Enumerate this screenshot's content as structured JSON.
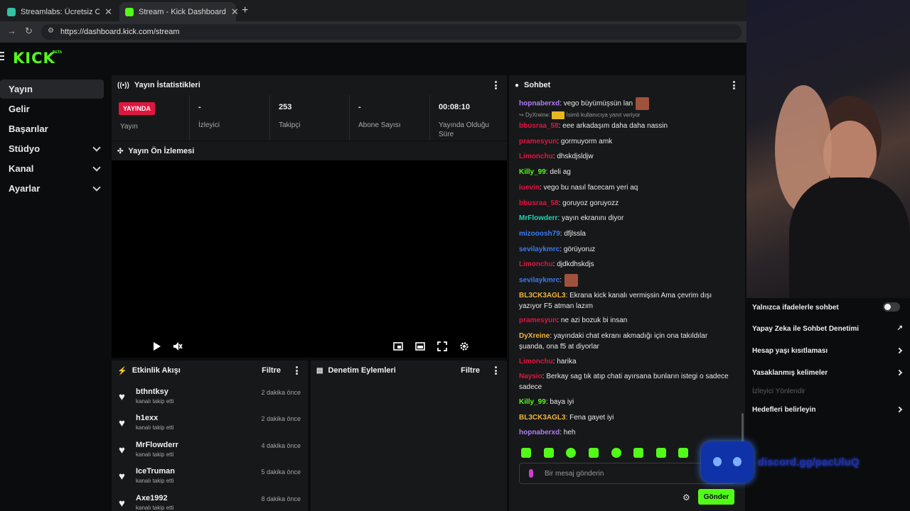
{
  "browser": {
    "tabs": [
      {
        "title": "Streamlabs: Ücretsiz Canlı Yayın",
        "color": "#31c3a2"
      },
      {
        "title": "Stream - Kick Dashboard",
        "color": "#53fc18"
      }
    ],
    "url": "https://dashboard.kick.com/stream"
  },
  "logo": {
    "text": "KICK",
    "beta": "BETA"
  },
  "sidebar": {
    "items": [
      {
        "label": "Yayın"
      },
      {
        "label": "Gelir"
      },
      {
        "label": "Başarılar"
      },
      {
        "label": "Stüdyo"
      },
      {
        "label": "Kanal"
      },
      {
        "label": "Ayarlar"
      }
    ]
  },
  "stats": {
    "title": "Yayın İstatistikleri",
    "live_badge": "YAYINDA",
    "cells": [
      {
        "value": "",
        "label": "Yayın"
      },
      {
        "value": "-",
        "label": "İzleyici"
      },
      {
        "value": "253",
        "label": "Takipçi"
      },
      {
        "value": "-",
        "label": "Abone Sayısı"
      },
      {
        "value": "00:08:10",
        "label": "Yayında Olduğu Süre"
      }
    ]
  },
  "preview": {
    "title": "Yayın Ön İzlemesi"
  },
  "activity": {
    "title": "Etkinlik Akışı",
    "filter": "Filtre",
    "items": [
      {
        "name": "bthntksy",
        "action": "kanalı takip etti",
        "time": "2 dakika önce"
      },
      {
        "name": "h1exx",
        "action": "kanalı takip etti",
        "time": "2 dakika önce"
      },
      {
        "name": "MrFlowderr",
        "action": "kanalı takip etti",
        "time": "4 dakika önce"
      },
      {
        "name": "IceTruman",
        "action": "kanalı takip etti",
        "time": "5 dakika önce"
      },
      {
        "name": "Axe1992",
        "action": "kanalı takip etti",
        "time": "8 dakika önce"
      }
    ]
  },
  "moderation": {
    "title": "Denetim Eylemleri",
    "filter": "Filtre"
  },
  "chat": {
    "title": "Sohbet",
    "reply_user": "DyXreine:",
    "reply_text": "İsimli kullanıcıya yanıt veriyor",
    "messages": [
      {
        "user": "hopnaberxd",
        "color": "#b07cf0",
        "text": "vego büyümüşsün lan"
      },
      {
        "user": "bbusraa_58",
        "color": "#e0163f",
        "text": "eee arkadaşım daha daha nassin"
      },
      {
        "user": "pramesyun",
        "color": "#e0163f",
        "text": "gormuyorm amk"
      },
      {
        "user": "Limonchu",
        "color": "#e0163f",
        "text": "dhskdjsldjw"
      },
      {
        "user": "Killy_99",
        "color": "#53fc18",
        "text": "deli ag"
      },
      {
        "user": "iuevin",
        "color": "#e0163f",
        "text": "vego bu nasıl facecam yeri aq"
      },
      {
        "user": "bbusraa_58",
        "color": "#e0163f",
        "text": "goruyoz goruyozz"
      },
      {
        "user": "MrFlowderr",
        "color": "#1ed8b0",
        "text": "yayın ekranını diyor"
      },
      {
        "user": "mizooosh79",
        "color": "#3a7bf0",
        "text": "dfjlssla"
      },
      {
        "user": "sevilaykmrc",
        "color": "#3a7bf0",
        "text": "görüyoruz"
      },
      {
        "user": "Limonchu",
        "color": "#e0163f",
        "text": "djdkdhskdjs"
      },
      {
        "user": "sevilaykmrc",
        "color": "#3a7bf0",
        "text": ""
      },
      {
        "user": "BL3CK3AGL3",
        "color": "#f0b43a",
        "text": "Ekrana kick kanalı vermişsin Ama çevrim dışı yazıyor F5 atman lazım"
      },
      {
        "user": "pramesyun",
        "color": "#e0163f",
        "text": "ne azi bozuk bi insan"
      },
      {
        "user": "DyXreine",
        "color": "#f0b43a",
        "text": "yayındaki chat ekranı akmadığı için ona takıldılar şuanda, ona f5 at diyorlar"
      },
      {
        "user": "Limonchu",
        "color": "#e0163f",
        "text": "harika"
      },
      {
        "user": "Naysio",
        "color": "#e0163f",
        "text": "Berkay sag tık atıp chati ayırsana bunların istegi o sadece sadece"
      },
      {
        "user": "Killy_99",
        "color": "#53fc18",
        "text": "baya iyi"
      },
      {
        "user": "BL3CK3AGL3",
        "color": "#f0b43a",
        "text": "Fena gayet iyi"
      },
      {
        "user": "hopnaberxd",
        "color": "#b07cf0",
        "text": "heh"
      }
    ],
    "input_placeholder": "Bir mesaj gönderin",
    "send_label": "Gönder"
  },
  "settings": {
    "items": [
      {
        "label": "Yalnızca ifadelerle sohbet"
      },
      {
        "label": "Yapay Zeka ile Sohbet Denetimi"
      },
      {
        "label": "Hesap yaşı kısıtlaması"
      },
      {
        "label": "Yasaklanmış kelimeler"
      },
      {
        "label": "İzleyici Yönlendir"
      },
      {
        "label": "Hedefleri belirleyin"
      }
    ]
  },
  "overlay": {
    "discord_text": "discord.gg/pacUluQ"
  }
}
